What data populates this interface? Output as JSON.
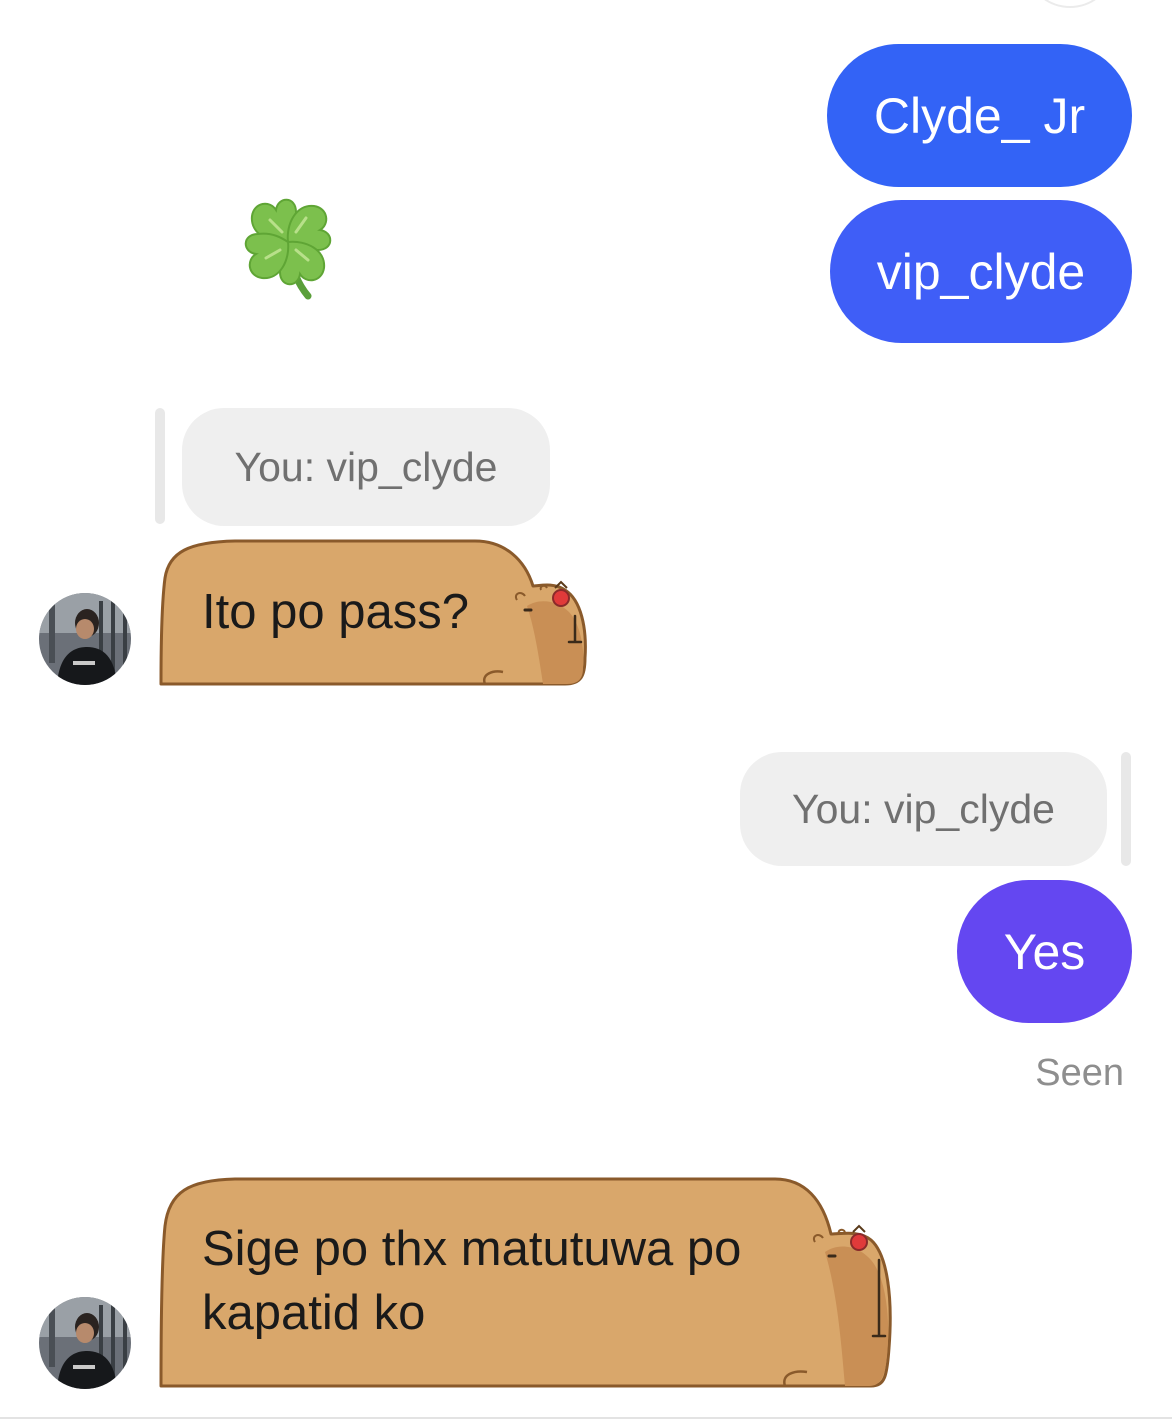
{
  "messages": {
    "outgoing_1": "Clyde_ Jr",
    "outgoing_2": "vip_clyde",
    "reply_quote_left": "You: vip_clyde",
    "incoming_1": "Ito po pass?",
    "reply_quote_right": "You: vip_clyde",
    "outgoing_3": "Yes",
    "status": "Seen",
    "incoming_2_line1": "Sige po thx matutuwa po",
    "incoming_2_line2": "kapatid ko"
  },
  "colors": {
    "outgoing_blue": "#3363f6",
    "outgoing_purple": "#6447f1",
    "reply_bg": "#efefef",
    "capybara_fill": "#d9a76b",
    "capybara_outline": "#8a5a2b"
  },
  "icons": {
    "sticker": "four-leaf-clover-icon",
    "bubble_theme": "capybara-bubble"
  }
}
